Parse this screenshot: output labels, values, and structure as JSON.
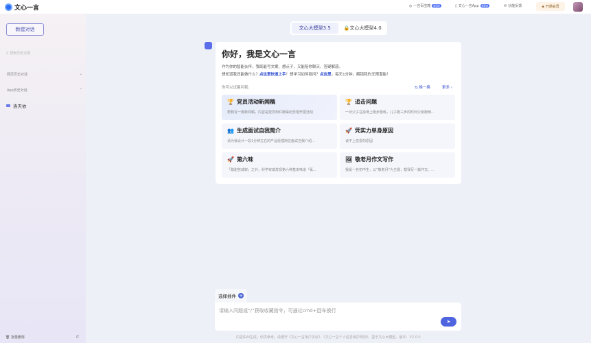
{
  "header": {
    "app_name": "文心一言",
    "items": [
      {
        "label": "一言百宝箱",
        "badge": "NEW"
      },
      {
        "label": "文心一言App",
        "badge": "NEW"
      },
      {
        "label": "功能反馈"
      }
    ],
    "vip": "开通会员"
  },
  "sidebar": {
    "new_chat": "新建对话",
    "search_placeholder": "搜索历史记录",
    "web_history": "网页历史对话",
    "app_history": "App历史对话",
    "chat_item": "洛天依",
    "batch_delete": "批量删除"
  },
  "tabs": [
    "文心大模型3.5",
    "文心大模型4.0"
  ],
  "welcome": {
    "title": "你好，我是文心一言",
    "line1": "作为你的智能伙伴，我既能写文案、想点子，又能陪你聊天、答疑解惑。",
    "line2_a": "想知道我还能做什么？",
    "line2_link1": "点这里快速上手",
    "line2_b": "！想学习如何提问？",
    "line2_link2": "点这里",
    "line2_c": "。每天1分钟，解锁我的无限潜能！",
    "try_label": "你可以试着问我:",
    "refresh": "换一换",
    "more": "更多"
  },
  "suggestions": [
    {
      "icon": "trophy",
      "title": "党员活动新闻稿",
      "desc": "帮我写一篇新闻稿，内容是党员到红旗渠纪念馆开展活动"
    },
    {
      "icon": "trophy",
      "title": "追击问题",
      "desc": "一对父子在操场上跑步晨练，儿子跑三步的时间父亲跑两..."
    },
    {
      "icon": "people",
      "title": "生成面试自我简介",
      "desc": "请为我设计一段1分钟左右的产品经理岗位面试自我介绍..."
    },
    {
      "icon": "rocket",
      "title": "凭实力单身原因",
      "desc": "谈不上恋爱的原因"
    },
    {
      "icon": "rocket",
      "title": "第六味",
      "desc": "「酸甜苦咸鲜」之外，科学家或发现第六种基本味道『氯..."
    },
    {
      "icon": "picture",
      "title": "敬老月作文写作",
      "desc": "我是一名初中生，以“敬老月”为主题，帮我写一篇作文。..."
    }
  ],
  "input": {
    "plugin": "选择插件",
    "placeholder": "请输入问题或“/”获取收藏指令，可通过cmd+回车换行"
  },
  "footer": "内容由AI生成，仅供参考。请遵守《文心一言用户协议》、《文心一言个人信息保护规则》，基于文心大模型，版本：V2.0.0",
  "colors": {
    "accent": "#4f65e0",
    "link": "#2a4ad0"
  }
}
